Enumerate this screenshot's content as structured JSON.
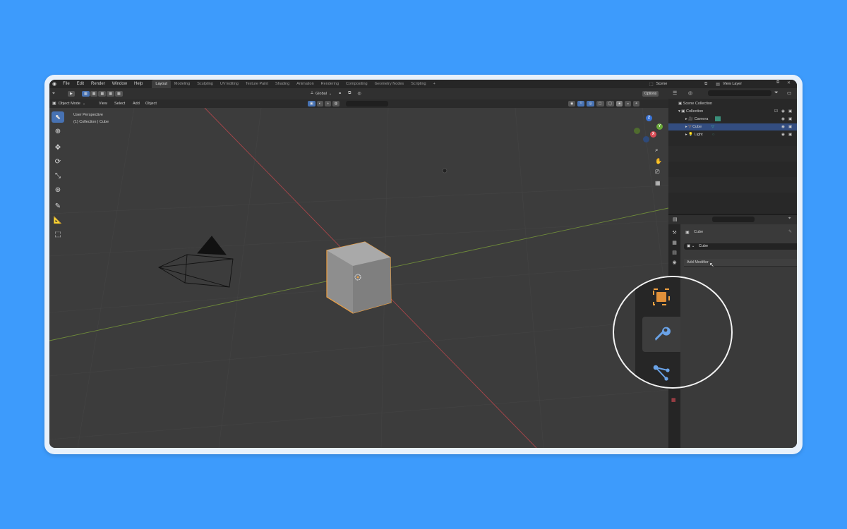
{
  "menu": {
    "items": [
      "File",
      "Edit",
      "Render",
      "Window",
      "Help"
    ]
  },
  "workspaces": [
    "Layout",
    "Modeling",
    "Sculpting",
    "UV Editing",
    "Texture Paint",
    "Shading",
    "Animation",
    "Rendering",
    "Compositing",
    "Geometry Nodes",
    "Scripting"
  ],
  "workspace_add": "+",
  "top_right": {
    "scene": "Scene",
    "view_layer": "View Layer"
  },
  "header": {
    "transform_orientation": "Global",
    "options": "Options",
    "object_mode": "Object Mode",
    "view_menus": [
      "View",
      "Select",
      "Add",
      "Object"
    ]
  },
  "viewport": {
    "perspective_label": "User Perspective",
    "collection_label": "(1) Collection | Cube",
    "gizmo_axes": {
      "x": "X",
      "y": "Y",
      "z": "Z"
    }
  },
  "outliner": {
    "scene_collection": "Scene Collection",
    "collection": "Collection",
    "items": [
      {
        "label": "Camera",
        "selected": false
      },
      {
        "label": "Cube",
        "selected": true
      },
      {
        "label": "Light",
        "selected": false
      }
    ]
  },
  "properties": {
    "object_name": "Cube",
    "modifier_object": "Cube",
    "add_modifier": "Add Modifier"
  },
  "colors": {
    "background": "#3d9bfc",
    "accent_blue": "#4772b3",
    "selection_orange": "#f0a040",
    "wrench_blue": "#6aa3e8"
  }
}
